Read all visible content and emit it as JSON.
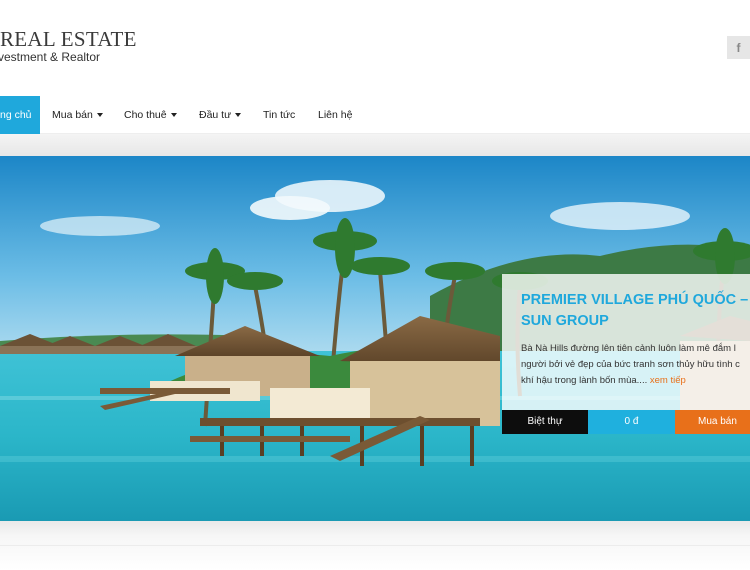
{
  "header": {
    "logo_title": "REAL ESTATE",
    "logo_subtitle": "vestment & Realtor",
    "social_icon": "facebook-icon",
    "social_label": "f"
  },
  "nav": {
    "items": [
      {
        "label": "ng chủ",
        "active": true,
        "dropdown": false
      },
      {
        "label": "Mua bán",
        "active": false,
        "dropdown": true
      },
      {
        "label": "Cho thuê",
        "active": false,
        "dropdown": true
      },
      {
        "label": "Đầu tư",
        "active": false,
        "dropdown": true
      },
      {
        "label": "Tin tức",
        "active": false,
        "dropdown": false
      },
      {
        "label": "Liên hệ",
        "active": false,
        "dropdown": false
      }
    ]
  },
  "slide": {
    "title_line1": "PREMIER VILLAGE PHÚ QUỐC –",
    "title_line2": "SUN GROUP",
    "desc_line1": "Bà Nà Hills đường lên tiên cảnh luôn làm mê đắm l",
    "desc_line2": "người bởi vẻ đẹp của bức tranh sơn thủy hữu tình c",
    "desc_line3": "khí hậu trong lành bốn mùa....",
    "read_more": "xem tiếp",
    "property_type": "Biệt thự",
    "price": "0 đ",
    "transaction": "Mua bán"
  },
  "colors": {
    "accent": "#1fa8dc",
    "orange": "#e8701a",
    "dark": "#0d0d0d"
  }
}
